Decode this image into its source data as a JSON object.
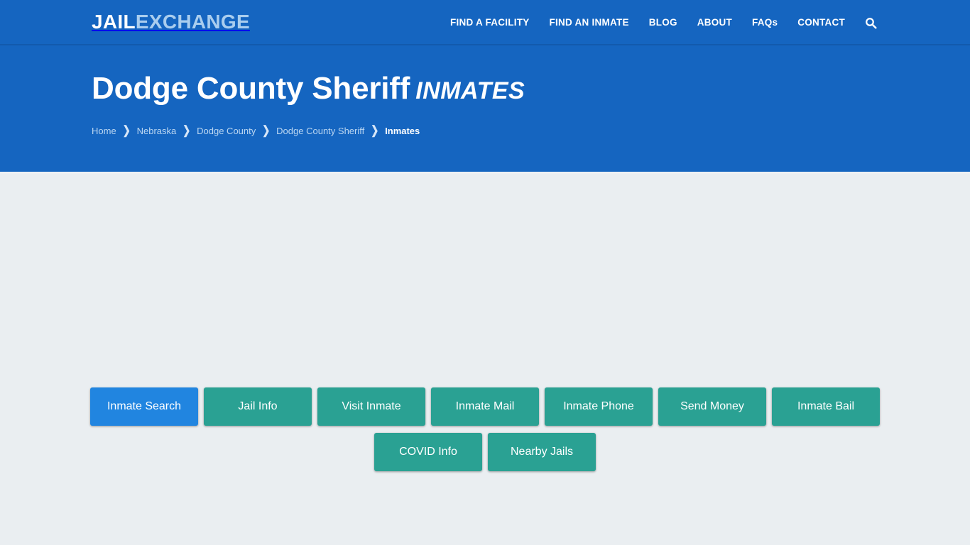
{
  "header": {
    "logo": {
      "part1": "JAIL",
      "part2": "EXCHANGE"
    },
    "nav": [
      {
        "label": "FIND A FACILITY",
        "name": "nav-find-a-facility"
      },
      {
        "label": "FIND AN INMATE",
        "name": "nav-find-an-inmate"
      },
      {
        "label": "BLOG",
        "name": "nav-blog"
      },
      {
        "label": "ABOUT",
        "name": "nav-about"
      },
      {
        "label": "FAQs",
        "name": "nav-faqs"
      },
      {
        "label": "CONTACT",
        "name": "nav-contact"
      }
    ],
    "search_icon": "search-icon"
  },
  "hero": {
    "title_subject": "Dodge County Sheriff",
    "title_kind": "INMATES",
    "breadcrumb": [
      {
        "label": "Home",
        "current": false
      },
      {
        "label": "Nebraska",
        "current": false
      },
      {
        "label": "Dodge County",
        "current": false
      },
      {
        "label": "Dodge County Sheriff",
        "current": false
      },
      {
        "label": "Inmates",
        "current": true
      }
    ],
    "breadcrumb_separator": "❯"
  },
  "main": {
    "buttons_row1": [
      {
        "label": "Inmate Search",
        "active": true
      },
      {
        "label": "Jail Info",
        "active": false
      },
      {
        "label": "Visit Inmate",
        "active": false
      },
      {
        "label": "Inmate Mail",
        "active": false
      },
      {
        "label": "Inmate Phone",
        "active": false
      },
      {
        "label": "Send Money",
        "active": false
      },
      {
        "label": "Inmate Bail",
        "active": false
      }
    ],
    "buttons_row2": [
      {
        "label": "COVID Info",
        "active": false
      },
      {
        "label": "Nearby Jails",
        "active": false
      }
    ]
  },
  "colors": {
    "header_blue": "#1565c0",
    "hero_blue": "#1565c0",
    "body_bg": "#eaeef1",
    "teal": "#2aa193",
    "active_blue": "#2185e0",
    "logo_accent": "#a9cdee"
  }
}
